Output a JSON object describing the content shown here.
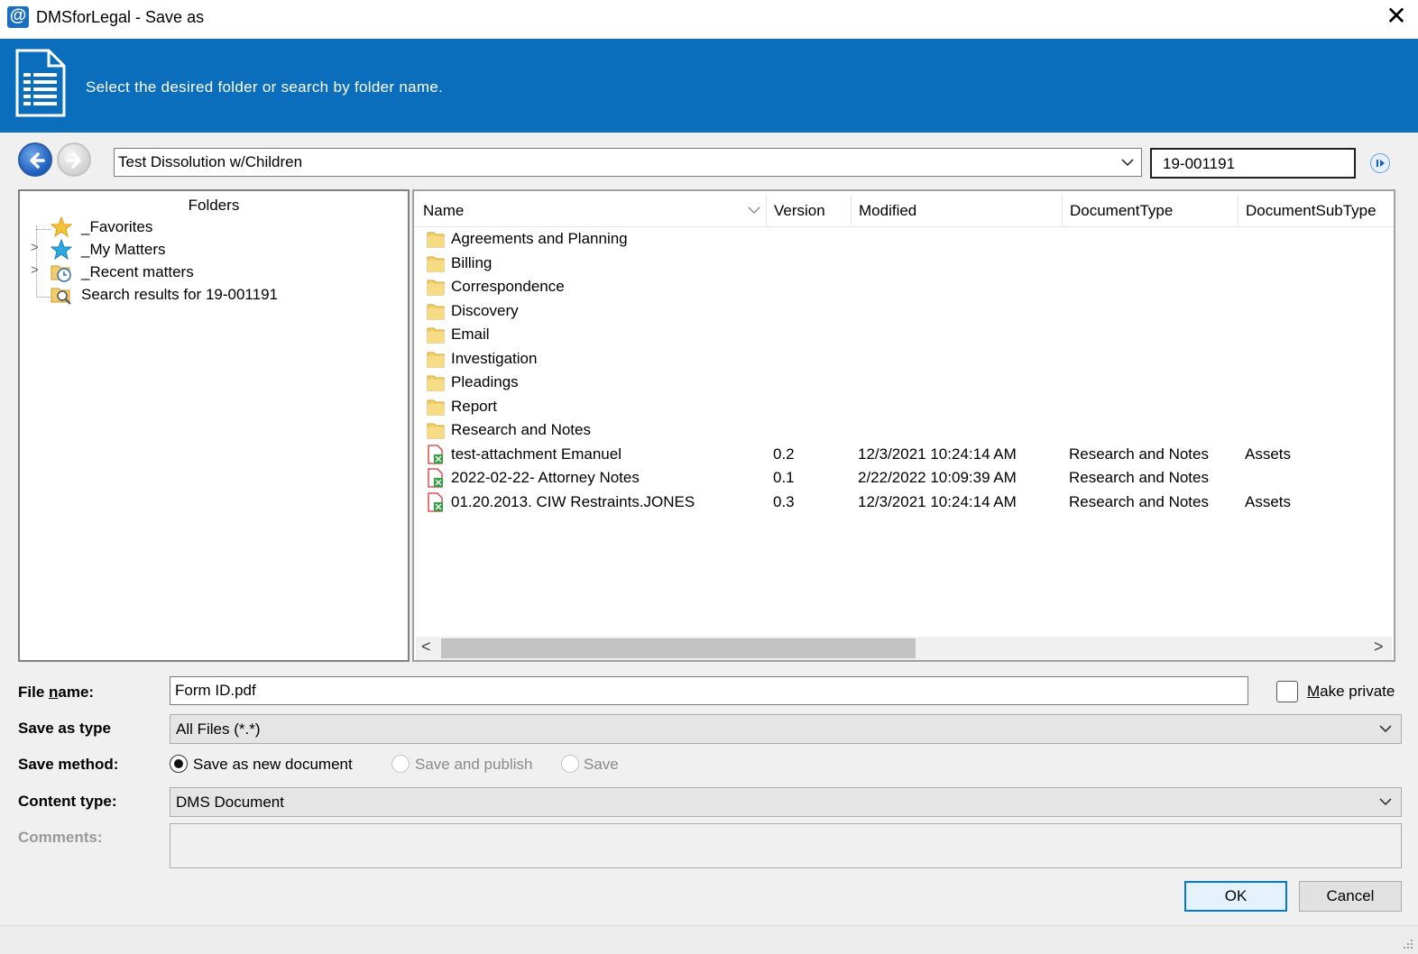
{
  "window": {
    "title": "DMSforLegal - Save as",
    "close": "✕",
    "app_icon": "@"
  },
  "banner": {
    "text": "Select the desired folder or search by folder name."
  },
  "nav": {
    "path": "Test Dissolution w/Children",
    "search_value": "19-001191"
  },
  "tree": {
    "header": "Folders",
    "items": [
      {
        "label": "_Favorites",
        "icon": "star-icon",
        "expandable": false
      },
      {
        "label": "_My Matters",
        "icon": "blue-star-icon",
        "expandable": true
      },
      {
        "label": "_Recent matters",
        "icon": "recent-folder-icon",
        "expandable": true
      },
      {
        "label": "Search results for 19-001191",
        "icon": "search-folder-icon",
        "expandable": false
      }
    ]
  },
  "list": {
    "columns": [
      "Name",
      "Version",
      "Modified",
      "DocumentType",
      "DocumentSubType"
    ],
    "folders": [
      "Agreements and Planning",
      "Billing",
      "Correspondence",
      "Discovery",
      "Email",
      "Investigation",
      "Pleadings",
      "Report",
      "Research and Notes"
    ],
    "documents": [
      {
        "name": "test-attachment Emanuel",
        "version": "0.2",
        "modified": "12/3/2021 10:24:14 AM",
        "type": "Research and Notes",
        "subtype": "Assets"
      },
      {
        "name": "2022-02-22- Attorney Notes",
        "version": "0.1",
        "modified": "2/22/2022 10:09:39 AM",
        "type": "Research and Notes",
        "subtype": ""
      },
      {
        "name": "01.20.2013. CIW Restraints.JONES",
        "version": "0.3",
        "modified": "12/3/2021 10:24:14 AM",
        "type": "Research and Notes",
        "subtype": "Assets"
      }
    ]
  },
  "form": {
    "file_name_label_pre": "File ",
    "file_name_label_u": "n",
    "file_name_label_post": "ame:",
    "file_name_value": "Form ID.pdf",
    "make_private_u": "M",
    "make_private_rest": "ake private",
    "save_as_type_label": "Save as type",
    "save_as_type_value": "All Files (*.*)",
    "save_method_label": "Save method:",
    "save_methods": [
      "Save as new document",
      "Save and publish",
      "Save"
    ],
    "content_type_label": "Content type:",
    "content_type_value": "DMS Document",
    "comments_label": "Comments:",
    "comments_value": ""
  },
  "buttons": {
    "ok": "OK",
    "cancel": "Cancel"
  },
  "colors": {
    "banner": "#0a6ebd",
    "accent": "#0078d7"
  }
}
